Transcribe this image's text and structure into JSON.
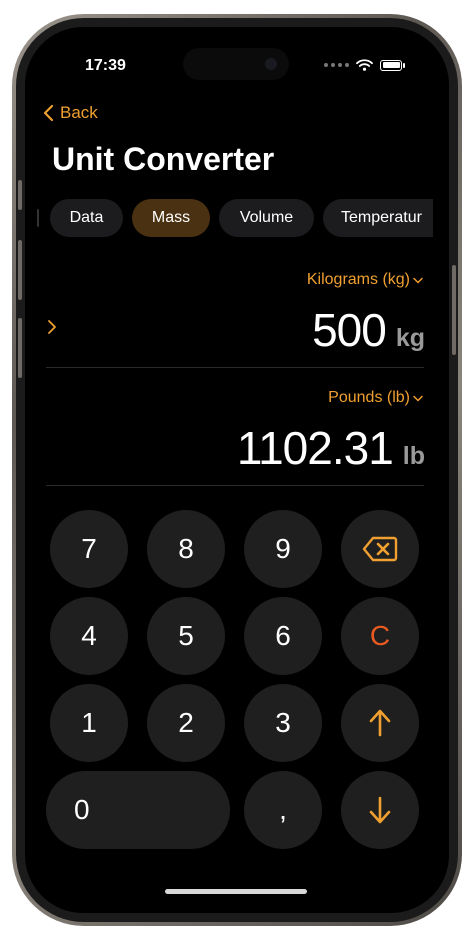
{
  "status_bar": {
    "time": "17:39"
  },
  "nav": {
    "back_label": "Back",
    "title": "Unit Converter"
  },
  "tabs": [
    {
      "label": "Data",
      "active": false
    },
    {
      "label": "Mass",
      "active": true
    },
    {
      "label": "Volume",
      "active": false
    },
    {
      "label": "Temperatur",
      "active": false
    }
  ],
  "input": {
    "unit_label": "Kilograms (kg)",
    "value": "500",
    "unit_symbol": "kg"
  },
  "output": {
    "unit_label": "Pounds (lb)",
    "value": "1102.31",
    "unit_symbol": "lb"
  },
  "keypad": {
    "k7": "7",
    "k8": "8",
    "k9": "9",
    "k4": "4",
    "k5": "5",
    "k6": "6",
    "k1": "1",
    "k2": "2",
    "k3": "3",
    "k0": "0",
    "comma": ",",
    "clear": "C",
    "backspace_icon": "delete-left-icon",
    "up_icon": "arrow-up-icon",
    "down_icon": "arrow-down-icon"
  },
  "colors": {
    "accent": "#f0a030",
    "clear": "#e85a20",
    "active_tab": "#4a3111",
    "key_bg": "#1f1f1f"
  }
}
